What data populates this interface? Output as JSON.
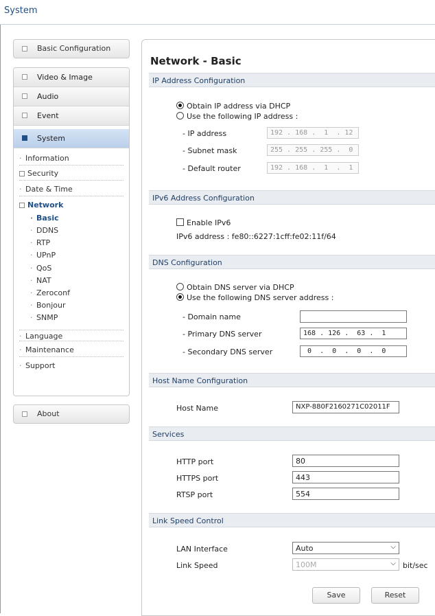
{
  "app": {
    "title": "System"
  },
  "sidebar": {
    "basic_configuration": "Basic Configuration",
    "video_image": "Video & Image",
    "audio": "Audio",
    "event": "Event",
    "system": "System",
    "system_items": {
      "information": "Information",
      "security": "Security",
      "date_time": "Date & Time",
      "network": "Network",
      "network_items": [
        "Basic",
        "DDNS",
        "RTP",
        "UPnP",
        "QoS",
        "NAT",
        "Zeroconf",
        "Bonjour",
        "SNMP"
      ],
      "language": "Language",
      "maintenance": "Maintenance",
      "support": "Support"
    },
    "about": "About"
  },
  "page": {
    "title": "Network - Basic",
    "ip_section": {
      "header": "IP Address Configuration",
      "dhcp_option": "Obtain IP address via DHCP",
      "static_option": "Use the following IP address :",
      "ip_label": "- IP address",
      "ip_value": "192 . 168 .  1  . 12",
      "subnet_label": "- Subnet mask",
      "subnet_value": "255 . 255 . 255 .  0",
      "router_label": "- Default router",
      "router_value": "192 . 168 .  1  .  1"
    },
    "ipv6_section": {
      "header": "IPv6 Address Configuration",
      "enable_label": "Enable IPv6",
      "address_text": "IPv6 address : fe80::6227:1cff:fe02:11f/64"
    },
    "dns_section": {
      "header": "DNS Configuration",
      "dhcp_option": "Obtain DNS server via DHCP",
      "static_option": "Use the following DNS server address :",
      "domain_label": "- Domain name",
      "domain_value": "",
      "primary_label": "- Primary DNS server",
      "primary_value": "168 . 126 .  63 .  1",
      "secondary_label": "- Secondary DNS server",
      "secondary_value": " 0  .  0  .  0  .  0"
    },
    "host_section": {
      "header": "Host Name Configuration",
      "label": "Host Name",
      "value": "NXP-880F2160271C02011F"
    },
    "services_section": {
      "header": "Services",
      "http_label": "HTTP port",
      "http_value": "80",
      "https_label": "HTTPS port",
      "https_value": "443",
      "rtsp_label": "RTSP port",
      "rtsp_value": "554"
    },
    "link_section": {
      "header": "Link Speed Control",
      "lan_label": "LAN Interface",
      "lan_value": "Auto",
      "speed_label": "Link Speed",
      "speed_value": "100M",
      "speed_unit": "bit/sec"
    },
    "save_label": "Save",
    "reset_label": "Reset"
  }
}
